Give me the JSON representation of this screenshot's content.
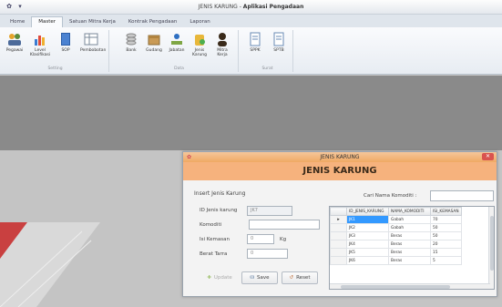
{
  "app": {
    "title_prefix": "JENIS KARUNG",
    "title_main": "Aplikasi Pengadaan",
    "qat_icons": [
      "app-icon",
      "dropdown-icon"
    ]
  },
  "tabs": [
    "Home",
    "Master",
    "Satuan Mitra Kerja",
    "Kontrak Pengadaan",
    "Laporan"
  ],
  "active_tab": 1,
  "ribbon": {
    "groups": [
      {
        "label": "Setting",
        "buttons": [
          "Pegawai",
          "Level Klasifikasi",
          "SOP",
          "Pembobotan"
        ]
      },
      {
        "label": "Data",
        "buttons": [
          "Bank",
          "Gudang",
          "Jabatan",
          "Jenis Karung",
          "Mitra Kerja"
        ]
      },
      {
        "label": "Surat",
        "buttons": [
          "SPPK",
          "SPTB"
        ]
      }
    ]
  },
  "dialog": {
    "title": "JENIS KARUNG",
    "header": "JENIS KARUNG",
    "insert_title": "Insert Jenis Karung",
    "fields": {
      "id_label": "ID Jenis karung",
      "id_value": "JK7",
      "komoditi_label": "Komoditi",
      "komoditi_value": "",
      "kemasan_label": "Isi Kemasan",
      "kemasan_value": "0",
      "kemasan_unit": "Kg",
      "berat_label": "Berat Tarra",
      "berat_value": "0"
    },
    "buttons": {
      "update": "Update",
      "save": "Save",
      "reset": "Reset"
    },
    "search_label": "Cari Nama Komoditi :",
    "search_value": "",
    "grid": {
      "columns": [
        "ID_JENIS_KARUNG",
        "NAMA_KOMODITI",
        "ISI_KEMASAN"
      ],
      "rows": [
        [
          "JK1",
          "Gabah",
          "70"
        ],
        [
          "JK2",
          "Gabah",
          "50"
        ],
        [
          "JK3",
          "Beras",
          "50"
        ],
        [
          "JK4",
          "Beras",
          "20"
        ],
        [
          "JK5",
          "Beras",
          "15"
        ],
        [
          "JK6",
          "Beras",
          "5"
        ]
      ],
      "selected_row": 0,
      "selected_col": 0
    }
  },
  "colors": {
    "dialog_title": "#f0a964",
    "dialog_header": "#f6b27d",
    "selection": "#3399ff",
    "close_button": "#d9534f"
  }
}
